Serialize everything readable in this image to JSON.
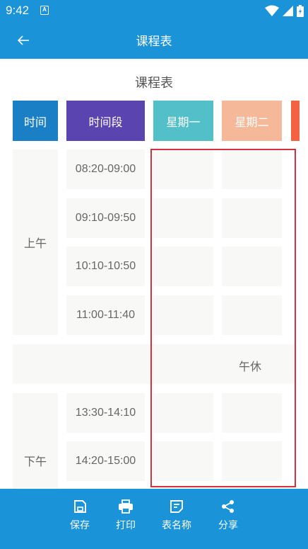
{
  "status": {
    "time": "9:42",
    "notif_glyph": "A"
  },
  "appbar": {
    "title": "课程表"
  },
  "table": {
    "caption": "课程表",
    "headers": {
      "time": "时间",
      "period": "时间段",
      "mon": "星期一",
      "tue": "星期二"
    },
    "morning_label": "上午",
    "afternoon_label": "下午",
    "lunch_label": "午休",
    "slots": [
      "08:20-09:00",
      "09:10-09:50",
      "10:10-10:50",
      "11:00-11:40",
      "13:30-14:10",
      "14:20-15:00"
    ]
  },
  "actions": {
    "save": "保存",
    "print": "打印",
    "table_name": "表名称",
    "share": "分享"
  },
  "colors": {
    "primary": "#1a93d8",
    "header_time": "#1a7fc4",
    "header_period": "#5a44b0",
    "header_mon": "#52bfc9",
    "header_tue": "#f5b898",
    "header_next": "#f56242",
    "highlight": "#d63040"
  }
}
